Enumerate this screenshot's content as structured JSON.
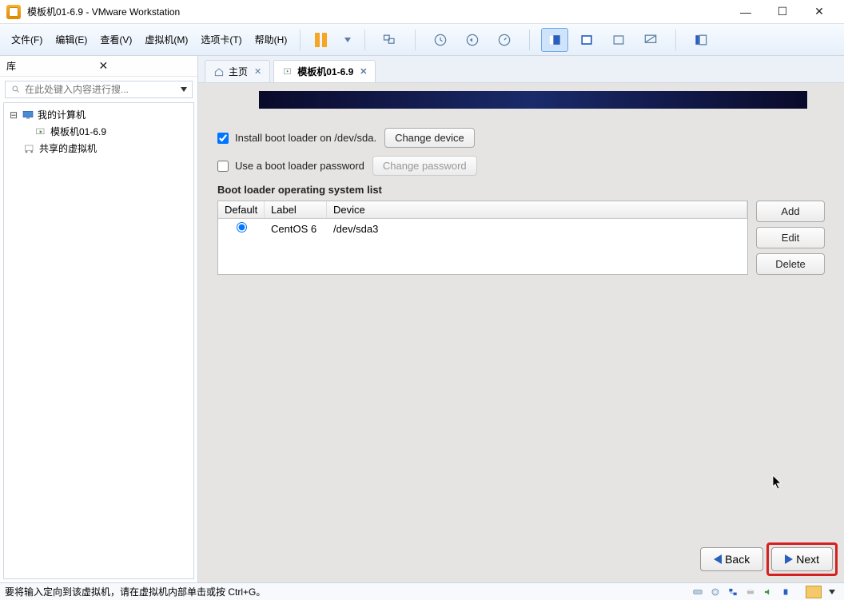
{
  "window": {
    "title": "模板机01-6.9 - VMware Workstation"
  },
  "menu": {
    "file": "文件(F)",
    "edit": "编辑(E)",
    "view": "查看(V)",
    "vm": "虚拟机(M)",
    "tabs": "选项卡(T)",
    "help": "帮助(H)"
  },
  "sidebar": {
    "title": "库",
    "search_placeholder": "在此处键入内容进行搜...",
    "root": "我的计算机",
    "items": [
      "模板机01-6.9",
      "共享的虚拟机"
    ]
  },
  "tabs": {
    "home": "主页",
    "vm": "模板机01-6.9"
  },
  "installer": {
    "install_bootloader_label": "Install boot loader on /dev/sda.",
    "change_device": "Change device",
    "use_password_label": "Use a boot loader password",
    "change_password": "Change password",
    "os_list_label": "Boot loader operating system list",
    "table": {
      "headers": {
        "default": "Default",
        "label": "Label",
        "device": "Device"
      },
      "rows": [
        {
          "default": true,
          "label": "CentOS 6",
          "device": "/dev/sda3"
        }
      ]
    },
    "buttons": {
      "add": "Add",
      "edit": "Edit",
      "delete": "Delete"
    },
    "nav": {
      "back": "Back",
      "next": "Next"
    }
  },
  "statusbar": {
    "text": "要将输入定向到该虚拟机，请在虚拟机内部单击或按 Ctrl+G。"
  }
}
